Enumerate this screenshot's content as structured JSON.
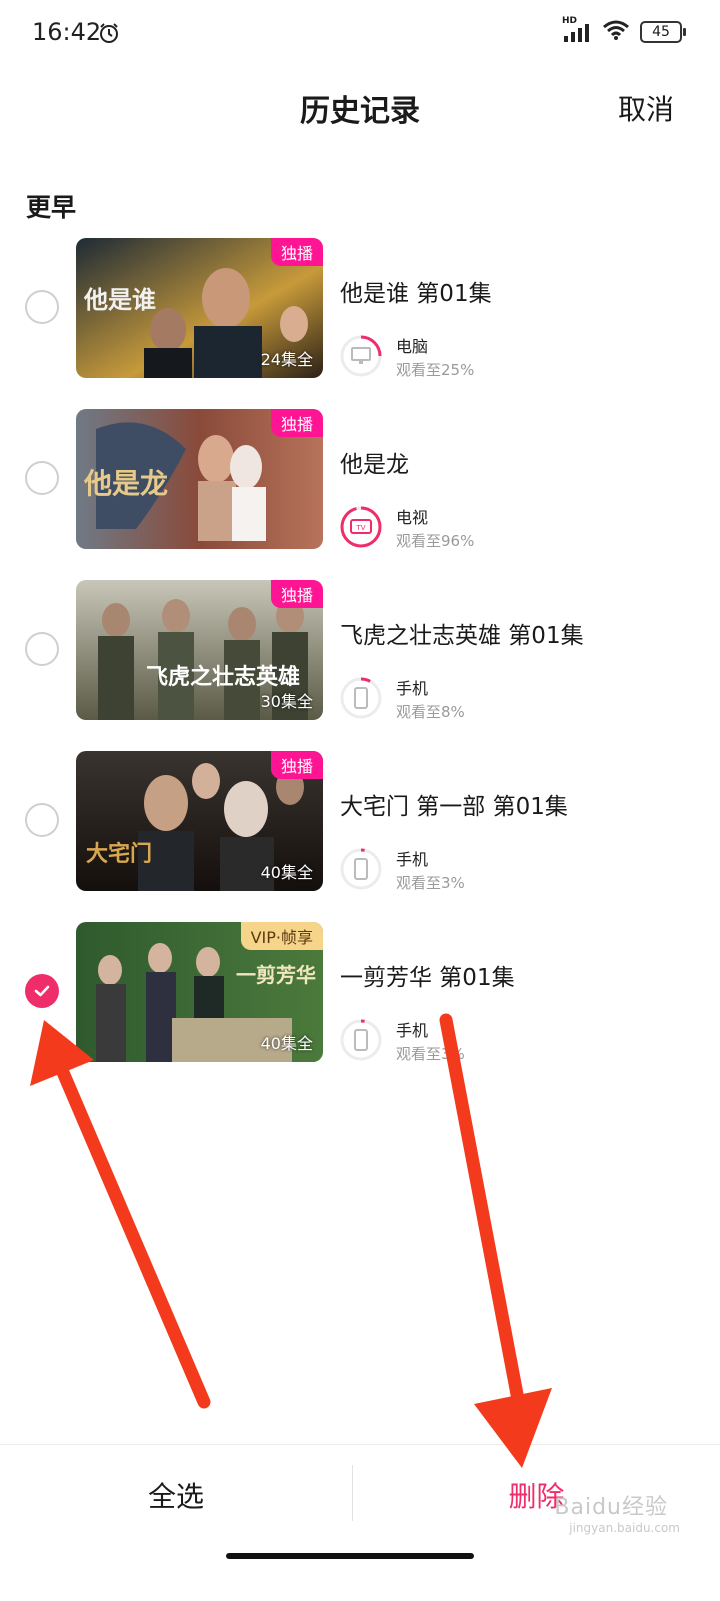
{
  "status_bar": {
    "time": "16:42",
    "hd": "HD",
    "battery": "45"
  },
  "header": {
    "title": "历史记录",
    "cancel_label": "取消"
  },
  "section_label": "更早",
  "items": [
    {
      "title": "他是谁 第01集",
      "badge": "独播",
      "episodes": "24集全",
      "device": "电脑",
      "progress_text": "观看至25%",
      "progress": 0.25,
      "device_icon": "monitor-icon",
      "selected": false,
      "poster_text": "他是谁"
    },
    {
      "title": "他是龙",
      "badge": "独播",
      "episodes": "",
      "device": "电视",
      "progress_text": "观看至96%",
      "progress": 0.96,
      "device_icon": "tv-icon",
      "selected": false,
      "poster_text": "他是龙"
    },
    {
      "title": "飞虎之壮志英雄 第01集",
      "badge": "独播",
      "episodes": "30集全",
      "device": "手机",
      "progress_text": "观看至8%",
      "progress": 0.08,
      "device_icon": "phone-icon",
      "selected": false,
      "poster_text": "飞虎之壮志英雄"
    },
    {
      "title": "大宅门 第一部 第01集",
      "badge": "独播",
      "episodes": "40集全",
      "device": "手机",
      "progress_text": "观看至3%",
      "progress": 0.03,
      "device_icon": "phone-icon",
      "selected": false,
      "poster_text": "大宅门"
    },
    {
      "title": "一剪芳华 第01集",
      "badge": "VIP·帧享",
      "episodes": "40集全",
      "device": "手机",
      "progress_text": "观看至3%",
      "progress": 0.03,
      "device_icon": "phone-icon",
      "selected": true,
      "poster_text": "一剪芳华"
    }
  ],
  "bottom_bar": {
    "select_all_label": "全选",
    "delete_label": "删除"
  },
  "watermark": {
    "text": "Baidu经验",
    "sub": "jingyan.baidu.com"
  },
  "colors": {
    "accent": "#ef2d6b",
    "badge": "#ff1493",
    "vip_badge": "#f6d48a",
    "annotation_arrow": "#f43a1c"
  }
}
